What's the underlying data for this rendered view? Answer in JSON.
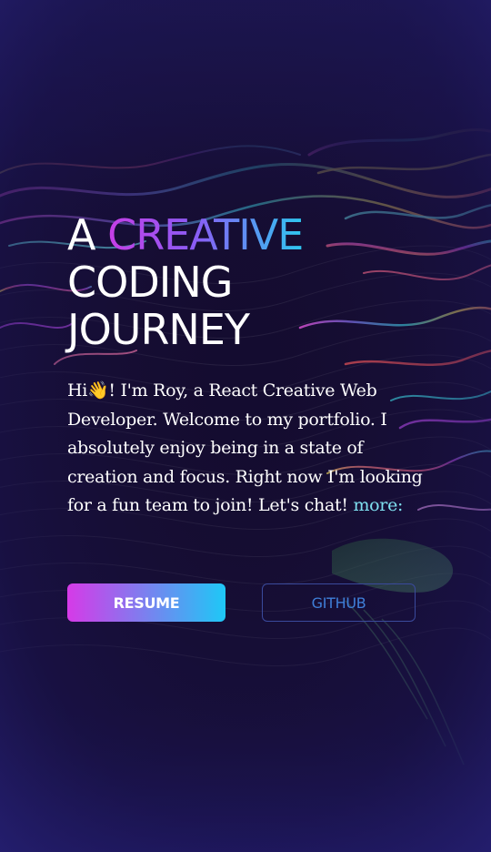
{
  "hero": {
    "title_word_1": "A ",
    "title_highlight": "Creative",
    "title_line_2": "Coding",
    "title_line_3": "Journey"
  },
  "bio": {
    "greeting": "Hi",
    "wave_emoji": "👋",
    "text": "! I'm Roy, a React Creative Web Developer. Welcome to my portfolio. I absolutely enjoy being in a state of creation and focus. Right now I'm looking for a fun team to join! Let's chat!",
    "more_link": "more:"
  },
  "buttons": {
    "resume": "Resume",
    "github": "Github"
  },
  "colors": {
    "background": "#120c33",
    "gradient_start": "#d63ae8",
    "gradient_end": "#1ec8f6",
    "link": "#7fe0f0",
    "github_text": "#3f7fd9"
  }
}
